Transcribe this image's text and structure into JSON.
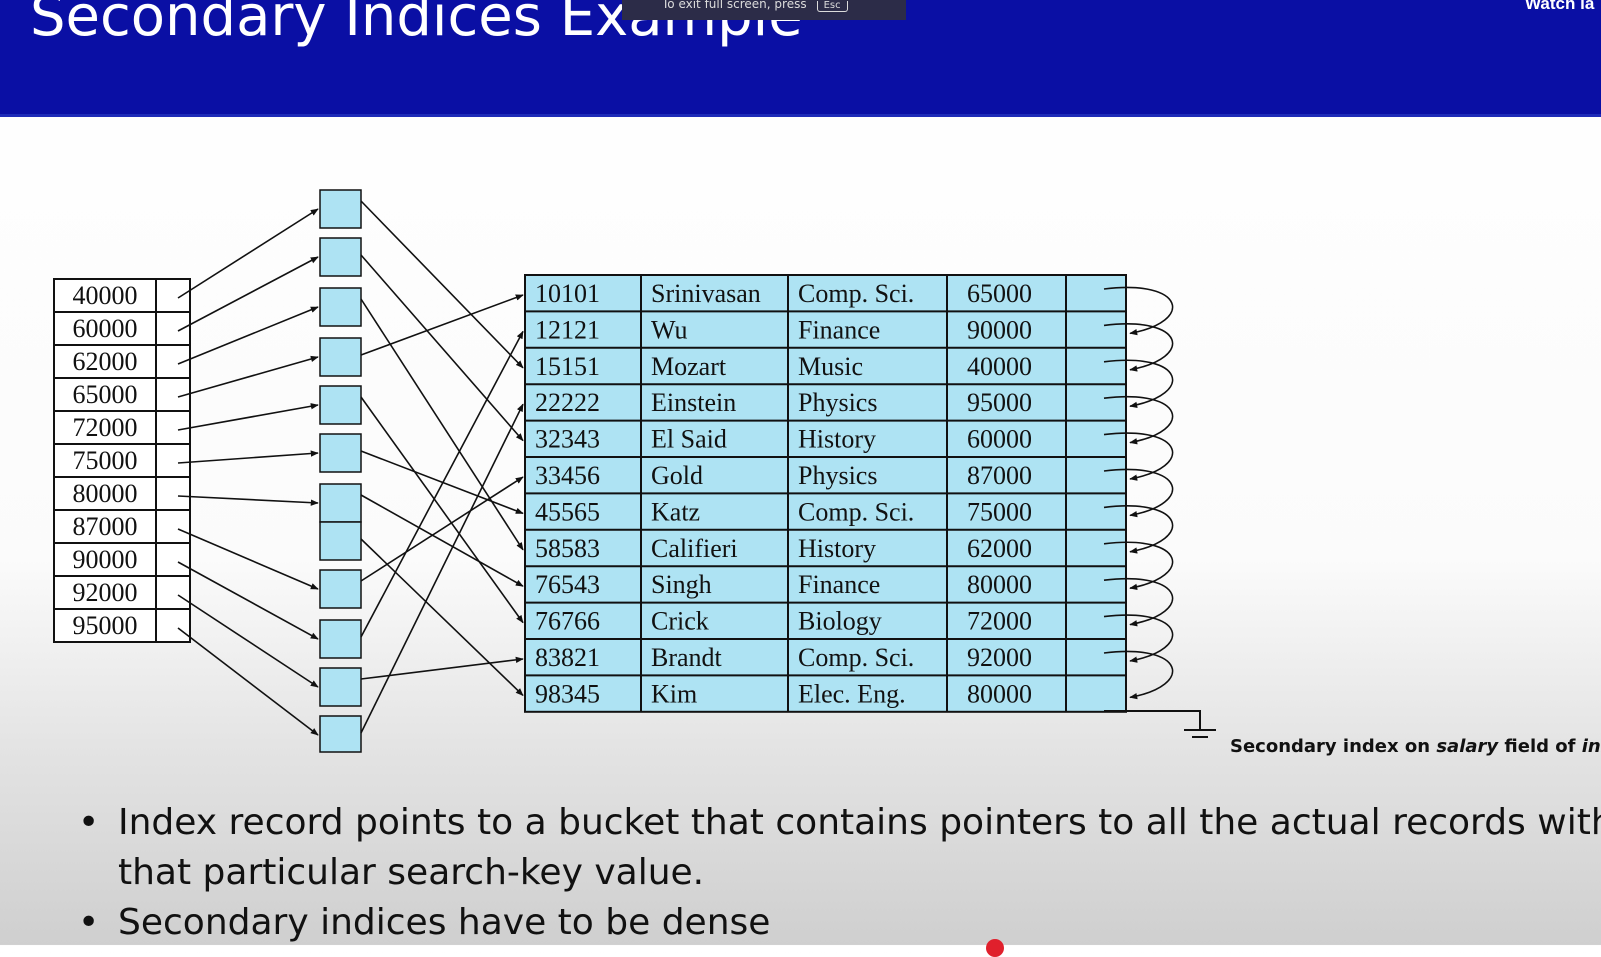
{
  "slide_title": "Secondary Indices Example",
  "fullscreen_notice": {
    "text": "To exit full screen, press",
    "key": "Esc"
  },
  "watch_later_label": "Watch la",
  "index_values": [
    "40000",
    "60000",
    "62000",
    "65000",
    "72000",
    "75000",
    "80000",
    "87000",
    "90000",
    "92000",
    "95000"
  ],
  "relation": {
    "rows": [
      [
        "10101",
        "Srinivasan",
        "Comp. Sci.",
        "65000"
      ],
      [
        "12121",
        "Wu",
        "Finance",
        "90000"
      ],
      [
        "15151",
        "Mozart",
        "Music",
        "40000"
      ],
      [
        "22222",
        "Einstein",
        "Physics",
        "95000"
      ],
      [
        "32343",
        "El Said",
        "History",
        "60000"
      ],
      [
        "33456",
        "Gold",
        "Physics",
        "87000"
      ],
      [
        "45565",
        "Katz",
        "Comp. Sci.",
        "75000"
      ],
      [
        "58583",
        "Califieri",
        "History",
        "62000"
      ],
      [
        "76543",
        "Singh",
        "Finance",
        "80000"
      ],
      [
        "76766",
        "Crick",
        "Biology",
        "72000"
      ],
      [
        "83821",
        "Brandt",
        "Comp. Sci.",
        "92000"
      ],
      [
        "98345",
        "Kim",
        "Elec. Eng.",
        "80000"
      ]
    ]
  },
  "caption": {
    "prefix": "Secondary index on ",
    "field": "salary",
    "middle": " field of ",
    "relation": "inst"
  },
  "bullets": [
    {
      "line1": "Index record points to a bucket that contains pointers to all the actual records with",
      "line2": "that particular search-key value."
    },
    {
      "line1": "Secondary indices have to be dense"
    }
  ],
  "colors": {
    "header": "#0a0fa4",
    "cell": "#aee3f3",
    "bucket": "#aee3f3"
  }
}
